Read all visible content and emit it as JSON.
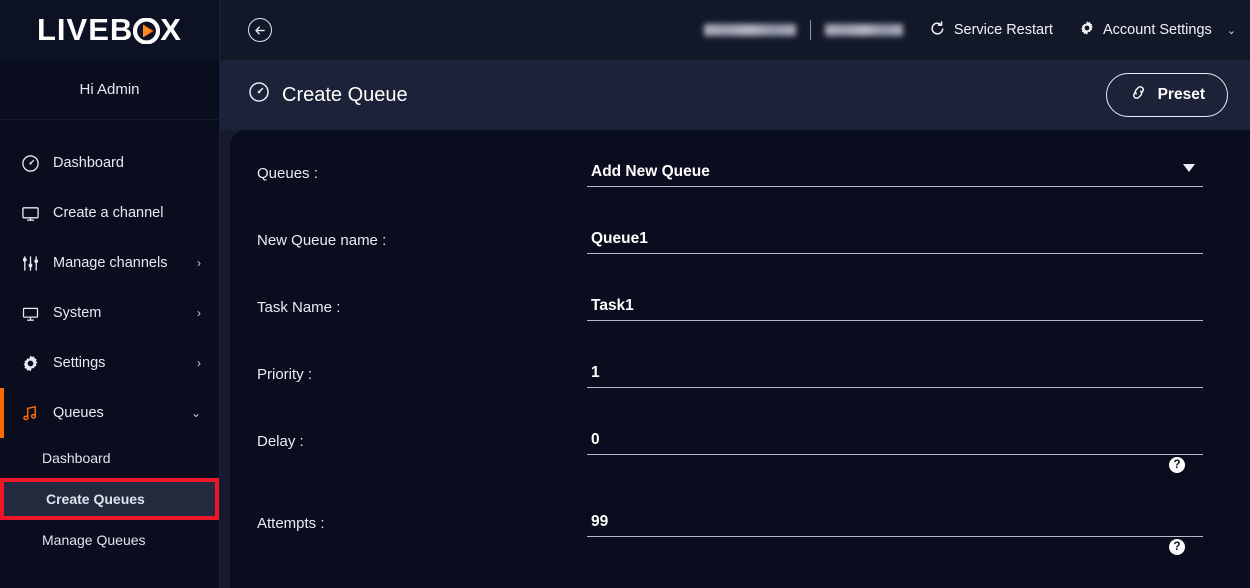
{
  "brand": {
    "name_left": "LIVEB",
    "name_right": "X",
    "greeting": "Hi Admin"
  },
  "sidebar": {
    "items": [
      {
        "label": "Dashboard",
        "icon": "gauge-icon",
        "chevron": ""
      },
      {
        "label": "Create a channel",
        "icon": "monitor-outline-icon",
        "chevron": ""
      },
      {
        "label": "Manage channels",
        "icon": "sliders-icon",
        "chevron": "›"
      },
      {
        "label": "System",
        "icon": "monitor-filled-icon",
        "chevron": "›"
      },
      {
        "label": "Settings",
        "icon": "gear-icon",
        "chevron": "›"
      },
      {
        "label": "Queues",
        "icon": "music-note-icon",
        "chevron": "⌄"
      }
    ],
    "sub_items": [
      {
        "label": "Dashboard"
      },
      {
        "label": "Create Queues"
      },
      {
        "label": "Manage Queues"
      }
    ]
  },
  "topbar": {
    "back_icon": "back-arrow-icon",
    "service_restart": "Service Restart",
    "account_settings": "Account Settings",
    "account_chevron": "⌄"
  },
  "header": {
    "title": "Create Queue",
    "title_icon": "gauge-icon",
    "preset_label": "Preset",
    "preset_icon": "link-chain-icon"
  },
  "form": {
    "fields": [
      {
        "label": "Queues :",
        "value": "Add New Queue",
        "dropdown": true,
        "help": false
      },
      {
        "label": "New Queue name :",
        "value": "Queue1",
        "dropdown": false,
        "help": false
      },
      {
        "label": "Task Name :",
        "value": "Task1",
        "dropdown": false,
        "help": false
      },
      {
        "label": "Priority :",
        "value": "1",
        "dropdown": false,
        "help": false
      },
      {
        "label": "Delay :",
        "value": "0",
        "dropdown": false,
        "help": true
      },
      {
        "label": "Attempts :",
        "value": "99",
        "dropdown": false,
        "help": true
      }
    ],
    "help_glyph": "?"
  },
  "colors": {
    "accent_orange": "#ff6a00",
    "highlight_red": "#f0162a",
    "bg_dark": "#0a0d1e"
  }
}
